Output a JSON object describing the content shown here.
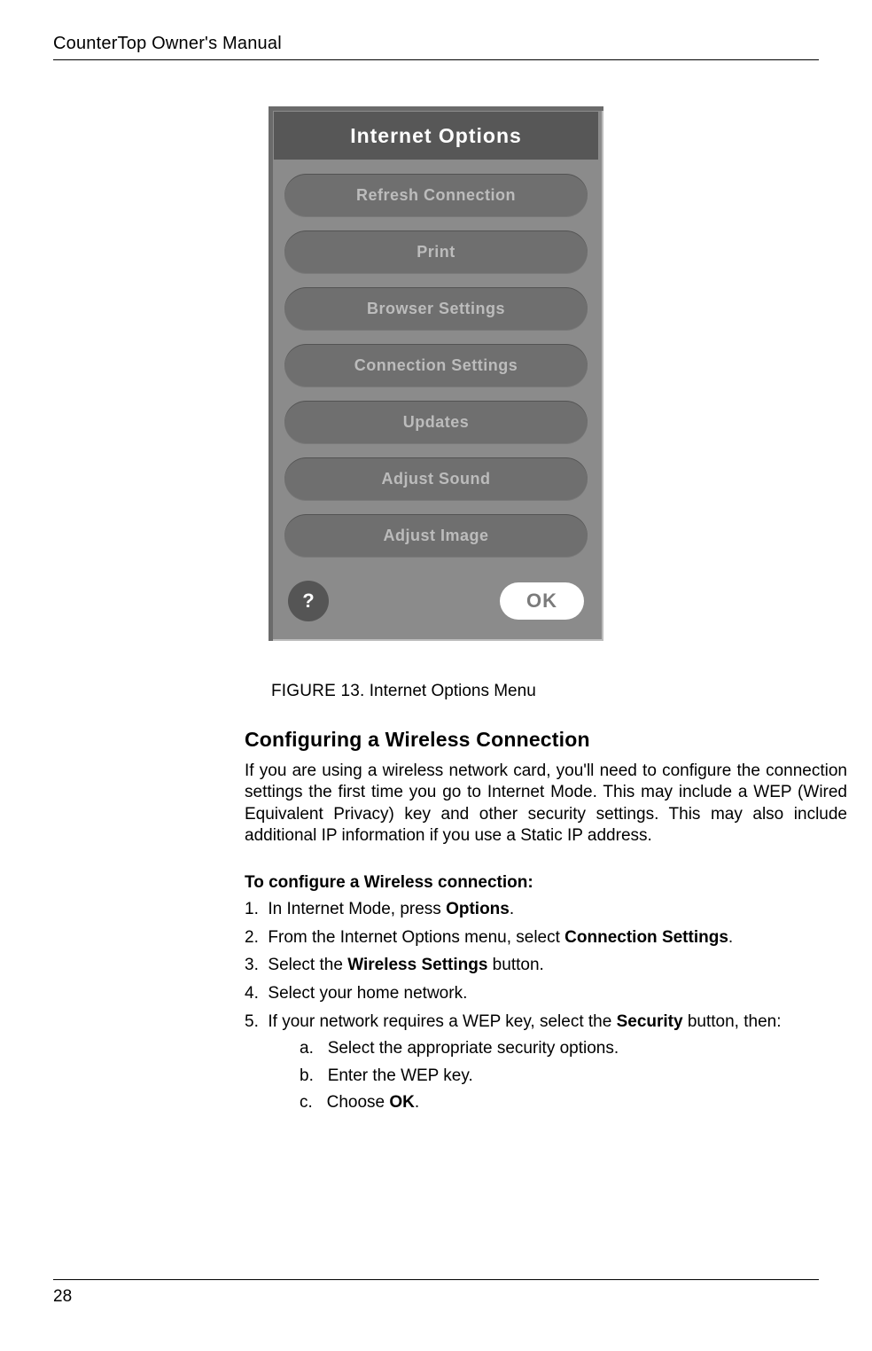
{
  "header": {
    "title": "CounterTop Owner's Manual"
  },
  "device": {
    "title": "Internet Options",
    "buttons": [
      "Refresh Connection",
      "Print",
      "Browser Settings",
      "Connection Settings",
      "Updates",
      "Adjust Sound",
      "Adjust Image"
    ],
    "help": "?",
    "ok": "OK"
  },
  "figure": {
    "label": "FIGURE 13.",
    "caption": "Internet Options Menu"
  },
  "section": {
    "heading": "Configuring a Wireless Connection",
    "intro": "If you are using a wireless network card, you'll need to configure the connection settings the first time you go to Internet Mode. This may include a WEP (Wired Equivalent Privacy) key and other security settings. This may also include additional IP information if you use a Static IP address.",
    "sub_heading": "To configure a Wireless connection:",
    "steps": {
      "s1_pre": "In Internet Mode, press ",
      "s1_b": "Options",
      "s1_post": ".",
      "s2_pre": "From the Internet Options menu, select ",
      "s2_b": "Connection Settings",
      "s2_post": ".",
      "s3_pre": "Select the  ",
      "s3_b": "Wireless Settings",
      "s3_post": " button.",
      "s4": "Select your home network.",
      "s5_pre": "If your network requires a WEP key, select the ",
      "s5_b": "Security",
      "s5_post": " button, then:",
      "a": "Select the appropriate security options.",
      "b": "Enter the WEP key.",
      "c_pre": "Choose ",
      "c_b": "OK",
      "c_post": "."
    }
  },
  "footer": {
    "page": "28"
  }
}
